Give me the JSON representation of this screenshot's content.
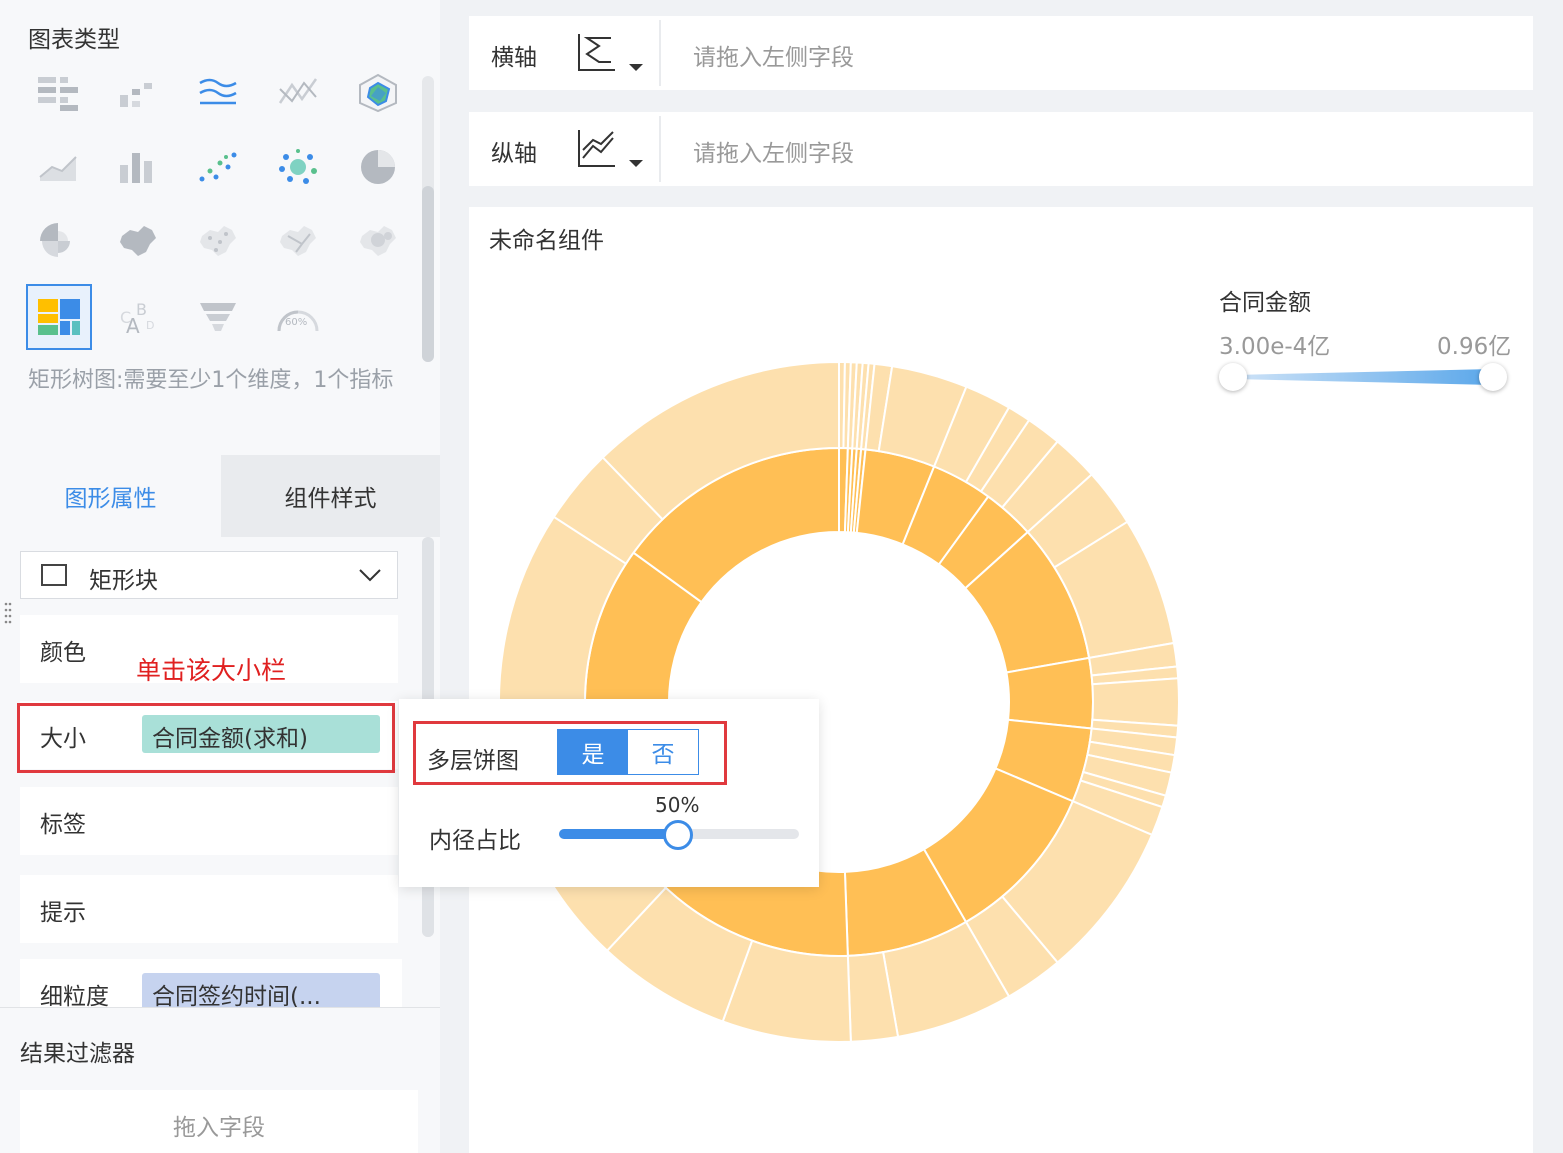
{
  "left_panel": {
    "chart_types_title": "图表类型",
    "chart_types": [
      {
        "name": "grouped-table-icon",
        "selected": false
      },
      {
        "name": "detail-table-icon",
        "selected": false
      },
      {
        "name": "multi-line-icon",
        "selected": false
      },
      {
        "name": "crossed-line-icon",
        "selected": false
      },
      {
        "name": "radar-icon",
        "selected": false
      },
      {
        "name": "area-line-icon",
        "selected": false
      },
      {
        "name": "bar-icon",
        "selected": false
      },
      {
        "name": "scatter-icon",
        "selected": false
      },
      {
        "name": "bubble-icon",
        "selected": false
      },
      {
        "name": "pie-icon",
        "selected": false
      },
      {
        "name": "rose-pie-icon",
        "selected": false
      },
      {
        "name": "region-map-icon",
        "selected": false
      },
      {
        "name": "point-map-icon",
        "selected": false
      },
      {
        "name": "flow-map-icon",
        "selected": false
      },
      {
        "name": "heat-map-icon",
        "selected": false
      },
      {
        "name": "treemap-icon",
        "selected": true
      },
      {
        "name": "word-cloud-icon",
        "selected": false
      },
      {
        "name": "funnel-icon",
        "selected": false
      },
      {
        "name": "gauge-icon",
        "selected": false,
        "text": "60%"
      }
    ],
    "chart_type_desc": "矩形树图:需要至少1个维度，1个指标",
    "tabs": {
      "shape_props": "图形属性",
      "component_style": "组件样式"
    },
    "mark_type": "矩形块",
    "props": {
      "color_label": "颜色",
      "size_label": "大小",
      "size_field": "合同金额(求和)",
      "label_label": "标签",
      "tooltip_label": "提示",
      "granularity_label": "细粒度",
      "granularity_field": "合同签约时间(..."
    },
    "annotation": "单击该大小栏",
    "filter_title": "结果过滤器",
    "filter_placeholder": "拖入字段"
  },
  "axes": {
    "x_label": "横轴",
    "y_label": "纵轴",
    "placeholder": "请拖入左侧字段"
  },
  "canvas": {
    "component_title": "未命名组件",
    "legend": {
      "title": "合同金额",
      "min": "3.00e-4亿",
      "max": "0.96亿"
    }
  },
  "popup": {
    "multilayer_label": "多层饼图",
    "yes": "是",
    "no": "否",
    "multilayer_on": true,
    "inner_radius_label": "内径占比",
    "inner_radius_value": "50%",
    "inner_radius_fraction": 0.5
  },
  "colors": {
    "accent": "#3c8ce7",
    "inner_ring": "#ffbf55",
    "outer_ring": "#fde0ae",
    "legend_gradient_start": "#cfe3f7",
    "legend_gradient_end": "#5aa7ea",
    "annotation_red": "#e0393e"
  }
}
